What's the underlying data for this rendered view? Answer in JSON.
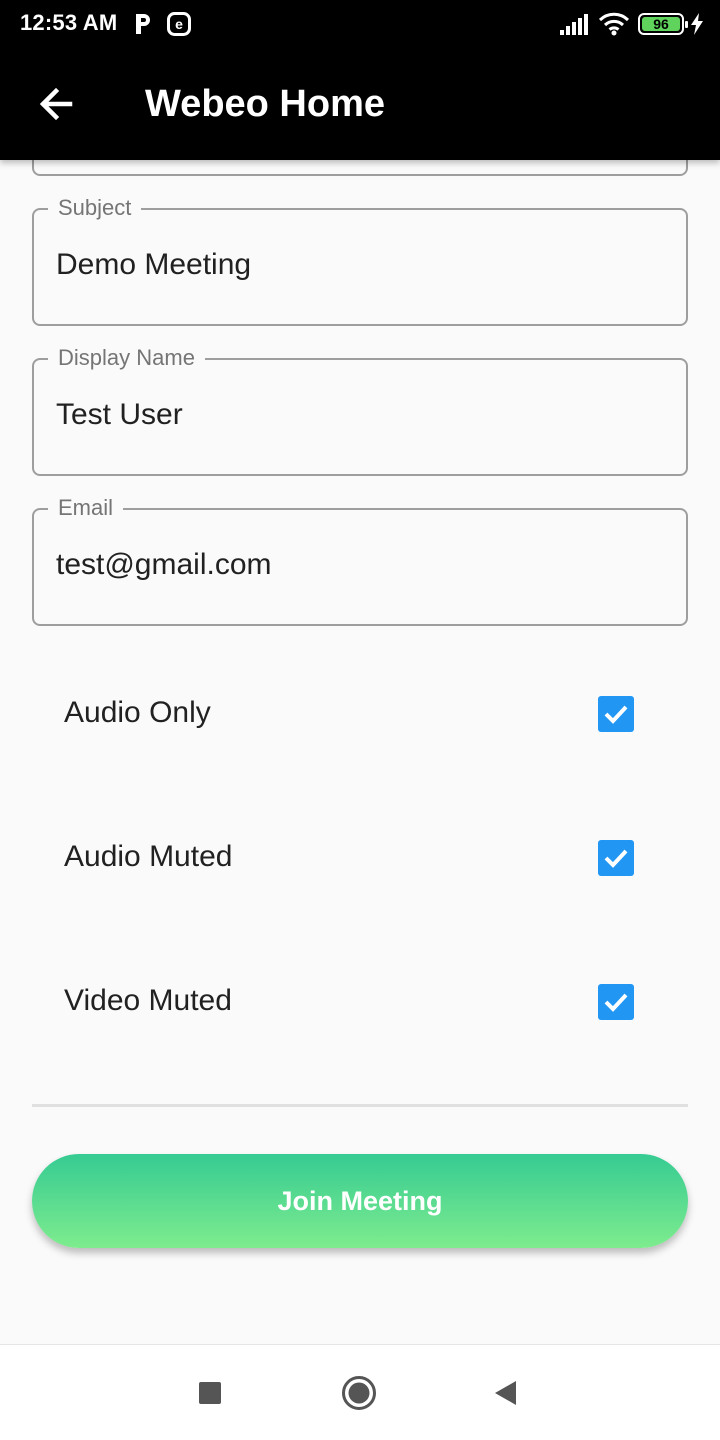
{
  "status_bar": {
    "time": "12:53 AM",
    "notification_icons": [
      "parking-icon",
      "e-app-icon"
    ],
    "battery_level": "96",
    "icons": [
      "signal-icon",
      "wifi-icon",
      "battery-icon",
      "charging-icon"
    ]
  },
  "app_bar": {
    "title": "Webeo Home",
    "back_icon": "back-arrow-icon"
  },
  "form": {
    "subject": {
      "label": "Subject",
      "value": "Demo Meeting"
    },
    "display_name": {
      "label": "Display Name",
      "value": "Test User"
    },
    "email": {
      "label": "Email",
      "value": "test@gmail.com"
    }
  },
  "options": [
    {
      "label": "Audio Only",
      "checked": true
    },
    {
      "label": "Audio Muted",
      "checked": true
    },
    {
      "label": "Video Muted",
      "checked": true
    }
  ],
  "join_button": {
    "label": "Join Meeting"
  },
  "colors": {
    "accent": "#2196f3",
    "button_gradient_top": "#36cb92",
    "button_gradient_bottom": "#7eec8e",
    "app_bar": "#000000"
  },
  "nav_bar": {
    "buttons": [
      "recents-square-icon",
      "home-circle-icon",
      "back-triangle-icon"
    ]
  }
}
